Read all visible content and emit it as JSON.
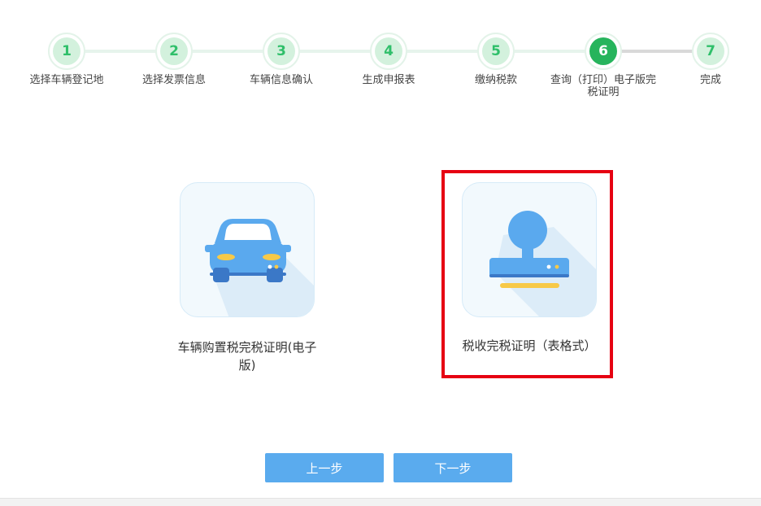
{
  "stepper": {
    "steps": [
      {
        "number": "1",
        "label": "选择车辆登记地"
      },
      {
        "number": "2",
        "label": "选择发票信息"
      },
      {
        "number": "3",
        "label": "车辆信息确认"
      },
      {
        "number": "4",
        "label": "生成申报表"
      },
      {
        "number": "5",
        "label": "缴纳税款"
      },
      {
        "number": "6",
        "label": "查询（打印）电子版完税证明",
        "active": true
      },
      {
        "number": "7",
        "label": "完成"
      }
    ]
  },
  "options": [
    {
      "label": "车辆购置税完税证明(电子版)",
      "icon": "car-icon"
    },
    {
      "label": "税收完税证明（表格式）",
      "icon": "stamp-icon",
      "highlighted": true
    }
  ],
  "buttons": {
    "prev": "上一步",
    "next": "下一步"
  },
  "colors": {
    "accent_green": "#26b45c",
    "step_inactive": "#d3f1dd",
    "button_blue": "#5aabee",
    "highlight_red": "#e60012",
    "icon_blue": "#5aa9ee"
  }
}
